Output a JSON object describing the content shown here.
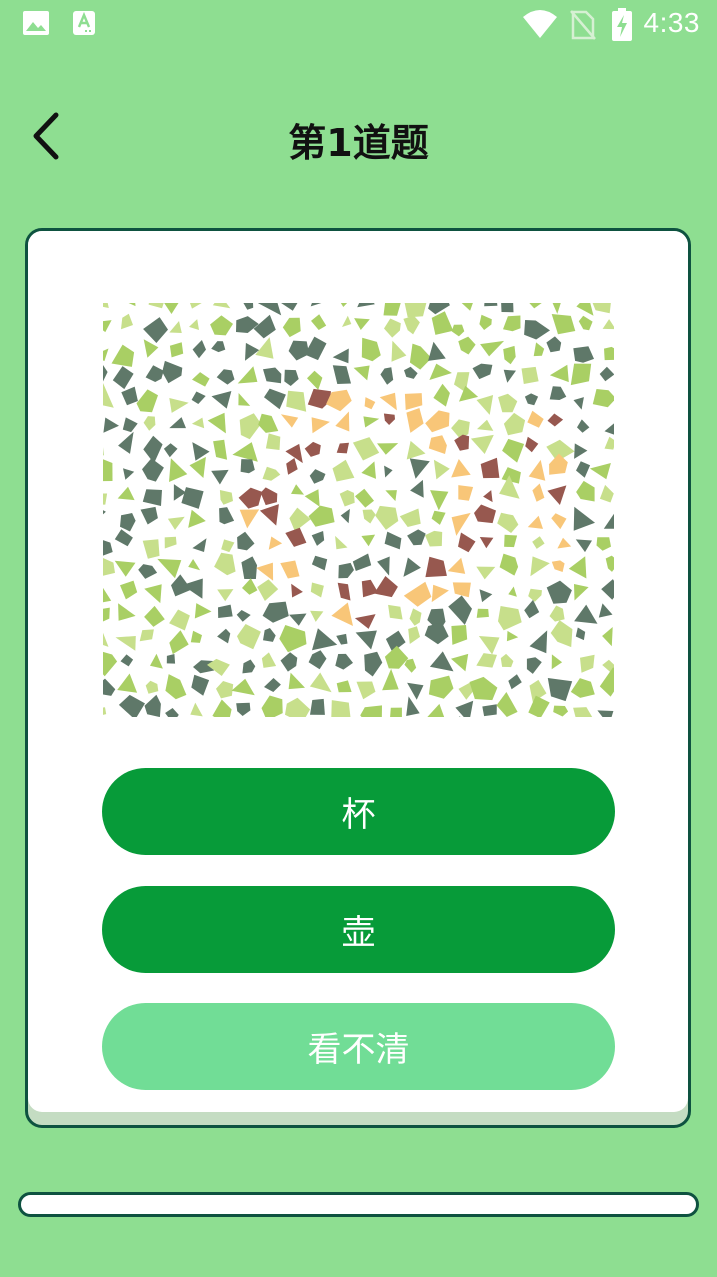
{
  "status_bar": {
    "time": "4:33",
    "icons": [
      "image-icon",
      "text-icon",
      "wifi-icon",
      "no-sim-icon",
      "battery-charging-icon"
    ]
  },
  "header": {
    "title": "第1道题",
    "back_icon": "chevron-left-icon"
  },
  "question": {
    "image": "color-blindness-test-plate",
    "colors": {
      "dot_dark": "#5f7869",
      "dot_green": "#a9cf64",
      "dot_light_green": "#c7df8b",
      "dot_orange": "#f8c678",
      "dot_brown": "#97584f"
    },
    "options": [
      {
        "label": "杯",
        "color": "#079b39"
      },
      {
        "label": "壶",
        "color": "#079b39"
      },
      {
        "label": "看不清",
        "color": "#71dd96"
      }
    ]
  },
  "progress": {
    "value": 0
  },
  "colors": {
    "background": "#8ede91",
    "card": "#ffffff",
    "border": "#0e5240",
    "primary_button": "#079b39",
    "secondary_button": "#71dd96"
  }
}
